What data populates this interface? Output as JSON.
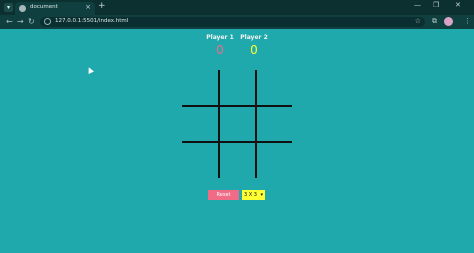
{
  "browser": {
    "tab_menu_icon": "chevron-down-icon",
    "tab_title": "document",
    "url": "127.0.0.1:5501/index.html",
    "tab_close": "×",
    "new_tab": "+",
    "minimize": "—",
    "maximize": "❐",
    "close": "✕",
    "back": "←",
    "forward": "→",
    "reload": "↻",
    "star": "☆"
  },
  "game": {
    "player1": {
      "name": "Player 1",
      "score": "0",
      "score_color": "#f06b86"
    },
    "player2": {
      "name": "Player 2",
      "score": "0",
      "score_color": "#ffff33"
    },
    "reset_label": "Reset",
    "size_select": {
      "selected": "3 X 3",
      "options": [
        "3 X 3"
      ]
    }
  }
}
